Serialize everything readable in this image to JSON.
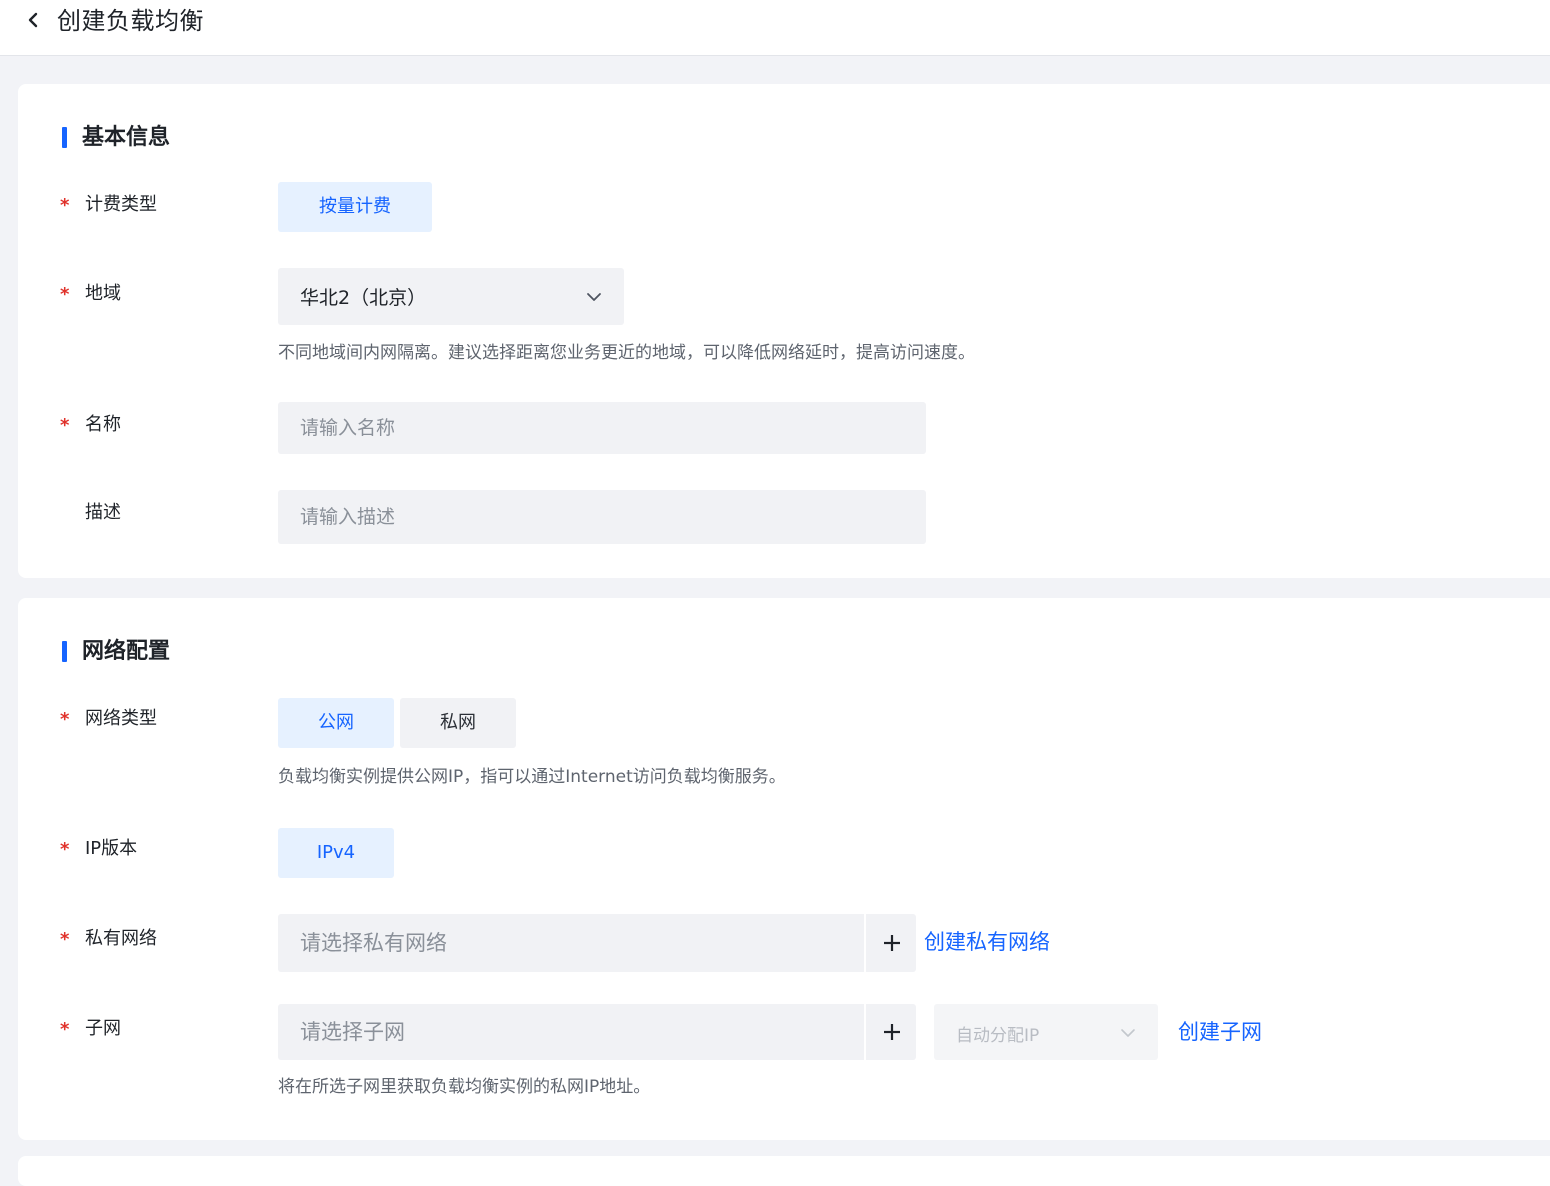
{
  "header": {
    "title": "创建负载均衡"
  },
  "basic_info": {
    "section_title": "基本信息",
    "billing": {
      "label": "计费类型",
      "required_mark": "*",
      "options": [
        {
          "label": "按量计费",
          "selected": true
        }
      ]
    },
    "region": {
      "label": "地域",
      "required_mark": "*",
      "value": "华北2（北京）",
      "hint": "不同地域间内网隔离。建议选择距离您业务更近的地域，可以降低网络延时，提高访问速度。"
    },
    "name": {
      "label": "名称",
      "required_mark": "*",
      "placeholder": "请输入名称",
      "value": ""
    },
    "description": {
      "label": "描述",
      "placeholder": "请输入描述",
      "value": ""
    }
  },
  "network_config": {
    "section_title": "网络配置",
    "network_type": {
      "label": "网络类型",
      "required_mark": "*",
      "options": [
        {
          "label": "公网",
          "selected": true
        },
        {
          "label": "私网",
          "selected": false
        }
      ],
      "hint": "负载均衡实例提供公网IP，指可以通过Internet访问负载均衡服务。"
    },
    "ip_version": {
      "label": "IP版本",
      "required_mark": "*",
      "options": [
        {
          "label": "IPv4",
          "selected": true
        }
      ]
    },
    "vpc": {
      "label": "私有网络",
      "required_mark": "*",
      "placeholder": "请选择私有网络",
      "create_link": "创建私有网络"
    },
    "subnet": {
      "label": "子网",
      "required_mark": "*",
      "placeholder": "请选择子网",
      "ip_select": "自动分配IP",
      "create_link": "创建子网",
      "hint": "将在所选子网里获取负载均衡实例的私网IP地址。"
    }
  },
  "colors": {
    "accent": "#1664ff",
    "required": "#e0322b",
    "selected_bg": "#e6f1ff",
    "input_bg": "#f1f2f5",
    "page_bg": "#f2f3f7"
  },
  "icons": {
    "back": "chevron-left-icon",
    "dropdown": "chevron-down-icon",
    "add": "plus-icon"
  }
}
